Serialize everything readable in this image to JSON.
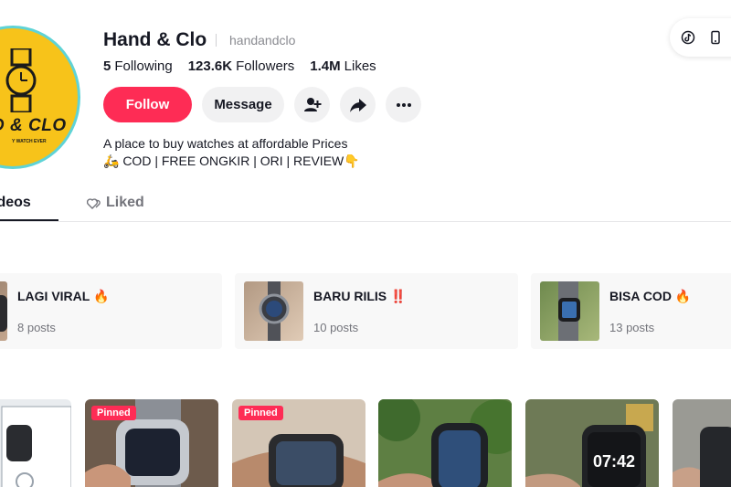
{
  "profile": {
    "name": "Hand & Clo",
    "handle": "handandclo",
    "avatar_text": "D & CLO",
    "avatar_tagline": "Y WATCH EVER",
    "stats": [
      {
        "value": "5",
        "label": "Following"
      },
      {
        "value": "123.6K",
        "label": "Followers"
      },
      {
        "value": "1.4M",
        "label": "Likes"
      }
    ],
    "bio_line1": "A place to buy watches at affordable Prices",
    "bio_line2": "🛵 COD | FREE ONGKIR | ORI | REVIEW👇"
  },
  "actions": {
    "follow_label": "Follow",
    "message_label": "Message"
  },
  "tabs": {
    "videos_label": "ideos",
    "liked_label": "Liked"
  },
  "collections": [
    {
      "title": "LAGI VIRAL 🔥",
      "count": "8 posts"
    },
    {
      "title": "BARU RILIS ‼️",
      "count": "10 posts"
    },
    {
      "title": "BISA COD 🔥",
      "count": "13 posts"
    }
  ],
  "videos": {
    "pinned_label": "Pinned",
    "watch_time": "07:42"
  },
  "colors": {
    "accent": "#fe2c55",
    "avatar_bg": "#f7c31a",
    "avatar_ring": "#5fd3d6"
  }
}
